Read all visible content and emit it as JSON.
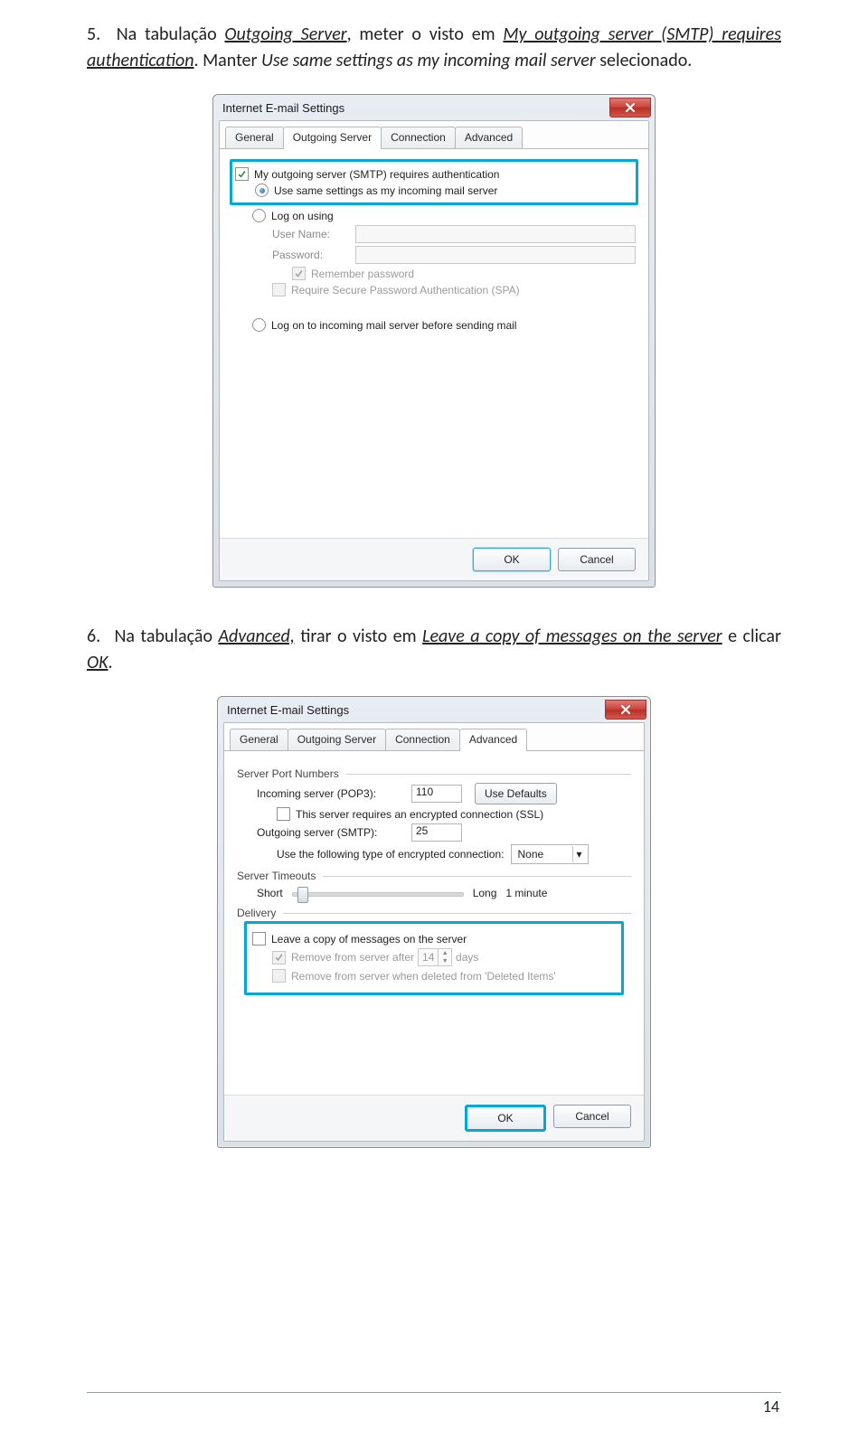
{
  "step5": {
    "num": "5.",
    "t1": "Na tabulação ",
    "u1": "Outgoing Server",
    "t2": ", meter o visto em ",
    "u2": "My outgoing server (SMTP) requires authentication",
    "t3": ". Manter ",
    "i1": "Use same settings as my incoming mail server",
    "t4": " selecionado."
  },
  "step6": {
    "num": "6.",
    "t1": "Na tabulação ",
    "u1": "Advanced,",
    "t2": " tirar o visto em ",
    "u2": "Leave a copy of messages on the server",
    "t3": " e clicar ",
    "u3": "OK",
    "t4": "."
  },
  "dlg1": {
    "title": "Internet E-mail Settings",
    "tabs": {
      "general": "General",
      "outgoing": "Outgoing Server",
      "connection": "Connection",
      "advanced": "Advanced"
    },
    "chk_auth": "My outgoing server (SMTP) requires authentication",
    "rad_same": "Use same settings as my incoming mail server",
    "rad_logon": "Log on using",
    "user": "User Name:",
    "pass": "Password:",
    "remember": "Remember password",
    "spa": "Require Secure Password Authentication (SPA)",
    "rad_before": "Log on to incoming mail server before sending mail",
    "ok": "OK",
    "cancel": "Cancel"
  },
  "dlg2": {
    "title": "Internet E-mail Settings",
    "tabs": {
      "general": "General",
      "outgoing": "Outgoing Server",
      "connection": "Connection",
      "advanced": "Advanced"
    },
    "grp_ports": "Server Port Numbers",
    "pop3_lbl": "Incoming server (POP3):",
    "pop3_val": "110",
    "defaults": "Use Defaults",
    "ssl": "This server requires an encrypted connection (SSL)",
    "smtp_lbl": "Outgoing server (SMTP):",
    "smtp_val": "25",
    "enc_lbl": "Use the following type of encrypted connection:",
    "enc_val": "None",
    "grp_timeout": "Server Timeouts",
    "short": "Short",
    "long": "Long",
    "long_val": "1 minute",
    "grp_delivery": "Delivery",
    "leave": "Leave a copy of messages on the server",
    "remove_after": "Remove from server after",
    "days_val": "14",
    "days": "days",
    "remove_del": "Remove from server when deleted from 'Deleted Items'",
    "ok": "OK",
    "cancel": "Cancel"
  },
  "page_num": "14"
}
